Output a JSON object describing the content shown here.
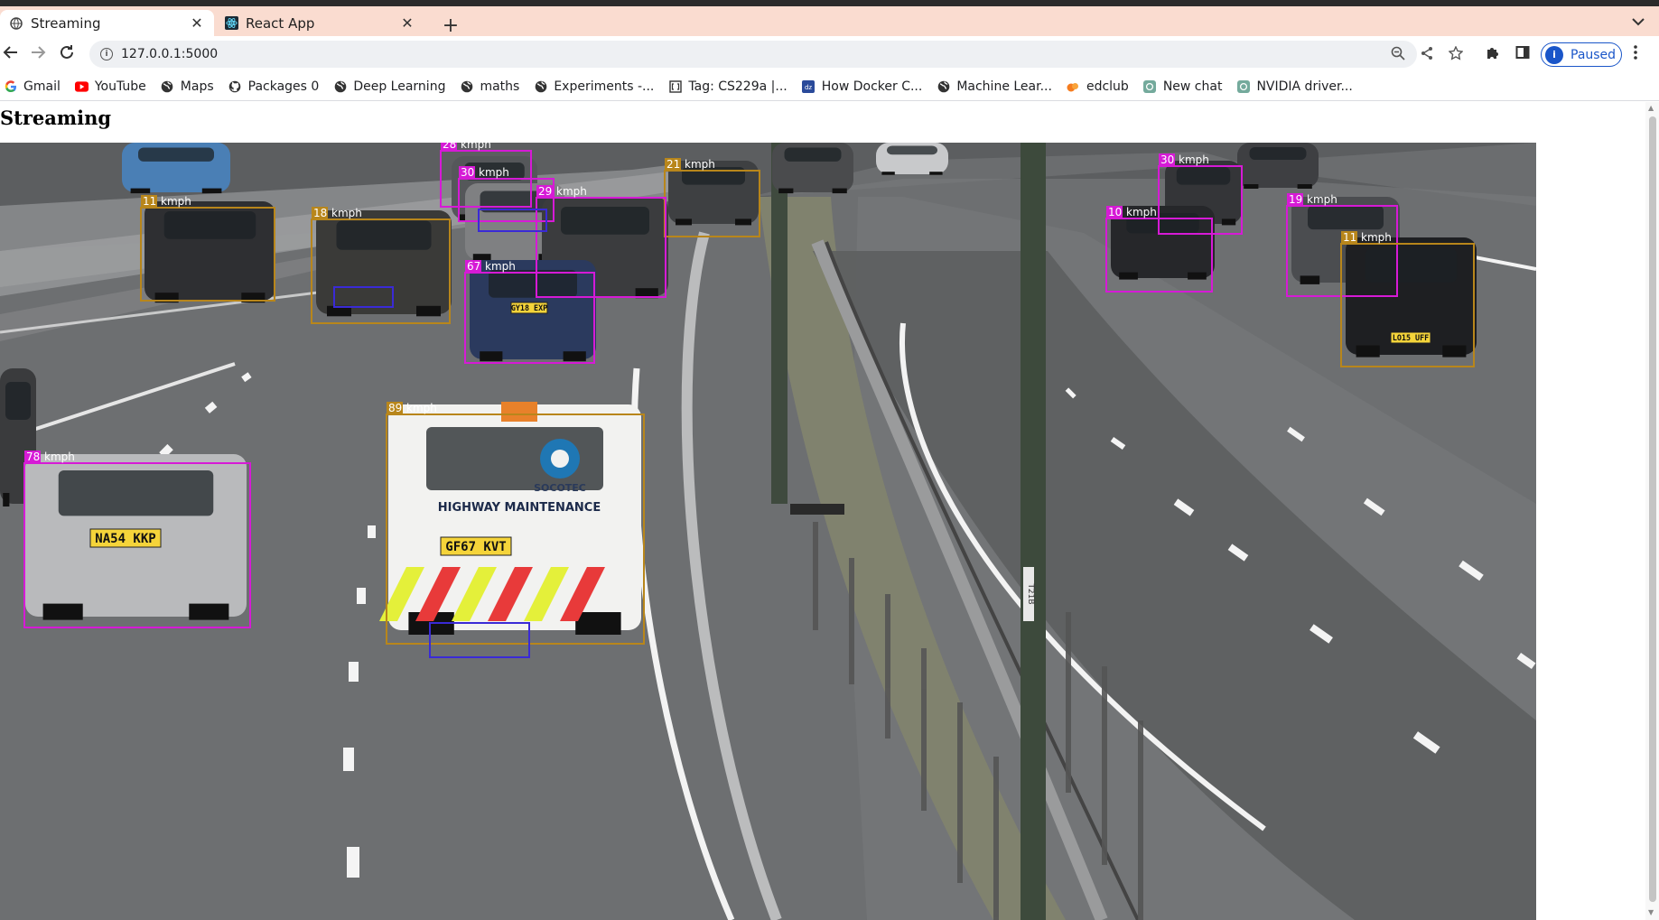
{
  "tabs": [
    {
      "title": "Streaming",
      "icon": "globe-icon",
      "active": true
    },
    {
      "title": "React App",
      "icon": "react-icon",
      "active": false
    }
  ],
  "toolbar": {
    "url": "127.0.0.1:5000",
    "profile_label": "Paused",
    "profile_initial": "i"
  },
  "bookmarks": [
    {
      "label": "Gmail",
      "icon": "google-icon"
    },
    {
      "label": "YouTube",
      "icon": "youtube-icon"
    },
    {
      "label": "Maps",
      "icon": "globe-icon"
    },
    {
      "label": "Packages 0",
      "icon": "github-icon"
    },
    {
      "label": "Deep Learning",
      "icon": "globe-icon"
    },
    {
      "label": "maths",
      "icon": "globe-icon"
    },
    {
      "label": "Experiments -...",
      "icon": "globe-icon"
    },
    {
      "label": "Tag: CS229a |...",
      "icon": "bracket-icon"
    },
    {
      "label": "How Docker C...",
      "icon": "docker-doc-icon"
    },
    {
      "label": "Machine Lear...",
      "icon": "globe-icon"
    },
    {
      "label": "edclub",
      "icon": "edclub-icon"
    },
    {
      "label": "New chat",
      "icon": "chatgpt-icon"
    },
    {
      "label": "NVIDIA driver...",
      "icon": "chatgpt-icon"
    }
  ],
  "page": {
    "heading": "Streaming"
  },
  "stream": {
    "speed_unit": "kmph",
    "detections": [
      {
        "speed": "28",
        "color": "#d61ad6"
      },
      {
        "speed": "30",
        "color": "#d61ad6"
      },
      {
        "speed": "21",
        "color": "#b8861b"
      },
      {
        "speed": "29",
        "color": "#d61ad6"
      },
      {
        "speed": "11",
        "color": "#b8861b"
      },
      {
        "speed": "18",
        "color": "#b8861b"
      },
      {
        "speed": "67",
        "color": "#d61ad6"
      },
      {
        "speed": "89",
        "color": "#b8861b"
      },
      {
        "speed": "78",
        "color": "#d61ad6"
      },
      {
        "speed": "30",
        "color": "#d61ad6"
      },
      {
        "speed": "10",
        "color": "#d61ad6"
      },
      {
        "speed": "19",
        "color": "#d61ad6"
      },
      {
        "speed": "11",
        "color": "#b8861b"
      }
    ],
    "plates": [
      "NA54 KKP",
      "GF67 KVT",
      "GY18 EXP",
      "LO15 UFF"
    ],
    "van_text": "HIGHWAY MAINTENANCE",
    "van_brand": "SOCOTEC",
    "pole_label": "T21B"
  },
  "colors": {
    "tabbar_bg": "#fadcd0",
    "detection_magenta": "#d61ad6",
    "detection_gold": "#b8861b",
    "profile_blue": "#1a56c9"
  }
}
